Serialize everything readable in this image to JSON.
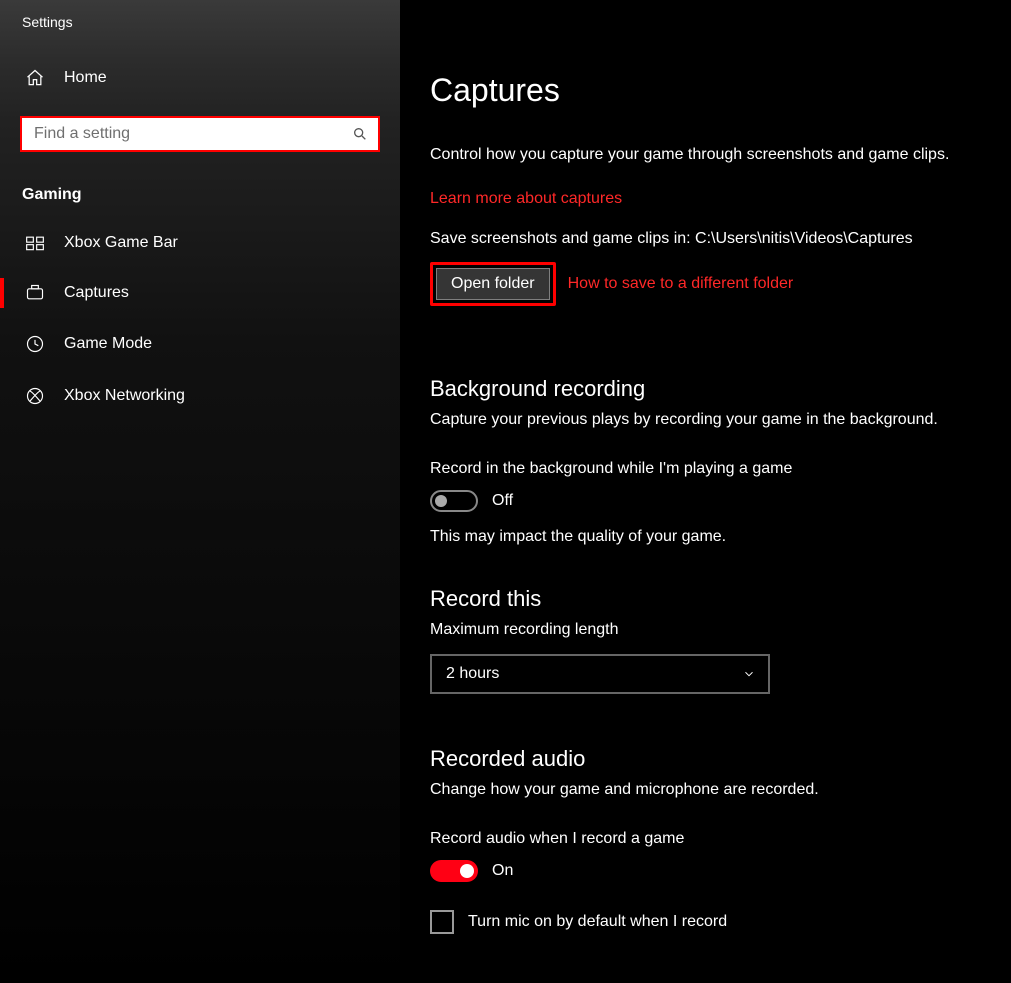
{
  "window": {
    "title": "Settings"
  },
  "sidebar": {
    "home_label": "Home",
    "search_placeholder": "Find a setting",
    "group_label": "Gaming",
    "items": [
      {
        "label": "Xbox Game Bar"
      },
      {
        "label": "Captures"
      },
      {
        "label": "Game Mode"
      },
      {
        "label": "Xbox Networking"
      }
    ]
  },
  "main": {
    "title": "Captures",
    "intro": "Control how you capture your game through screenshots and game clips.",
    "learn_more": "Learn more about captures",
    "save_path_label": "Save screenshots and game clips in: C:\\Users\\nitis\\Videos\\Captures",
    "open_folder_btn": "Open folder",
    "how_link": "How to save to a different folder",
    "bg_heading": "Background recording",
    "bg_sub": "Capture your previous plays by recording your game in the background.",
    "bg_toggle_label": "Record in the background while I'm playing a game",
    "bg_toggle_state": "Off",
    "bg_hint": "This may impact the quality of your game.",
    "rt_heading": "Record this",
    "rt_sub": "Maximum recording length",
    "rt_value": "2 hours",
    "ra_heading": "Recorded audio",
    "ra_sub": "Change how your game and microphone are recorded.",
    "ra_toggle_label": "Record audio when I record a game",
    "ra_toggle_state": "On",
    "ra_check_label": "Turn mic on by default when I record"
  },
  "colors": {
    "accent": "#ff0000"
  }
}
